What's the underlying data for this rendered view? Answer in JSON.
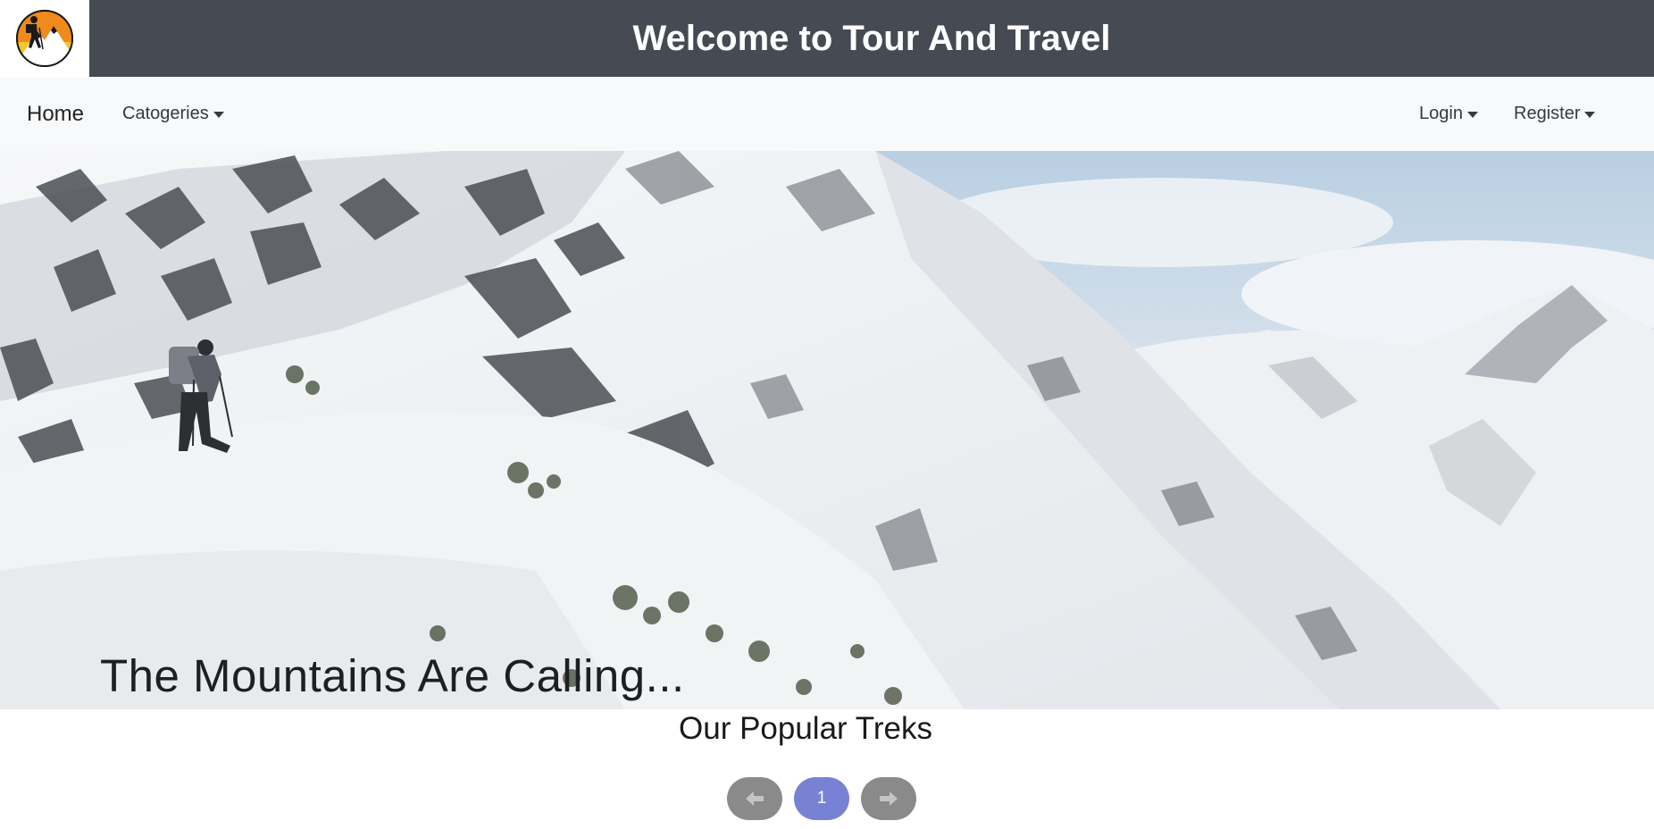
{
  "header": {
    "title": "Welcome to Tour And Travel",
    "logo_icon": "hiker-mountain-logo-icon"
  },
  "nav": {
    "home": "Home",
    "categories": "Catogeries",
    "login": "Login",
    "register": "Register"
  },
  "hero": {
    "caption": "The Mountains Are Calling..."
  },
  "treks": {
    "title": "Our Popular Treks",
    "pagination": {
      "prev_icon": "arrow-left-icon",
      "current_page": "1",
      "next_icon": "arrow-right-icon"
    }
  },
  "colors": {
    "header_bg": "#464a52",
    "nav_bg": "#f8f9fa",
    "page_active": "#7882d4",
    "page_button": "#8a8a8a",
    "logo_accent": "#f4b21b"
  }
}
